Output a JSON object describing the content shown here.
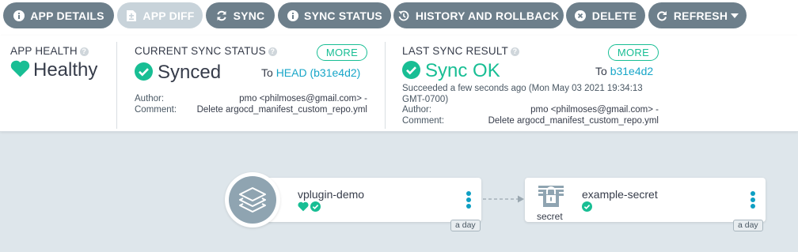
{
  "toolbar": {
    "app_details": "APP DETAILS",
    "app_diff": "APP DIFF",
    "sync": "SYNC",
    "sync_status": "SYNC STATUS",
    "history_rollback": "HISTORY AND ROLLBACK",
    "delete": "DELETE",
    "refresh": "REFRESH"
  },
  "app_health": {
    "label": "APP HEALTH",
    "value": "Healthy"
  },
  "current_sync": {
    "label": "CURRENT SYNC STATUS",
    "more": "MORE",
    "value": "Synced",
    "to_prefix": "To",
    "revision": "HEAD (b31e4d2)",
    "author_label": "Author:",
    "author": "pmo <philmoses@gmail.com> -",
    "comment_label": "Comment:",
    "comment": "Delete argocd_manifest_custom_repo.yml"
  },
  "last_sync": {
    "label": "LAST SYNC RESULT",
    "more": "MORE",
    "value": "Sync OK",
    "to_prefix": "To",
    "revision": "b31e4d2",
    "succeeded_line1": "Succeeded a few seconds ago (Mon May 03 2021 19:34:13",
    "succeeded_line2": "GMT-0700)",
    "author_label": "Author:",
    "author": "pmo <philmoses@gmail.com> -",
    "comment_label": "Comment:",
    "comment": "Delete argocd_manifest_custom_repo.yml"
  },
  "graph": {
    "app_node": {
      "name": "vplugin-demo",
      "age": "a day",
      "icon": "layers-icon"
    },
    "secret_node": {
      "name": "example-secret",
      "kind": "secret",
      "age": "a day",
      "icon": "lock-icon"
    }
  },
  "colors": {
    "button": "#6d7f8b",
    "button_disabled": "#c8d3da",
    "healthy": "#18be94",
    "link": "#18a6c8",
    "kebab": "#0e9fc3",
    "canvas": "#dee6eb"
  }
}
